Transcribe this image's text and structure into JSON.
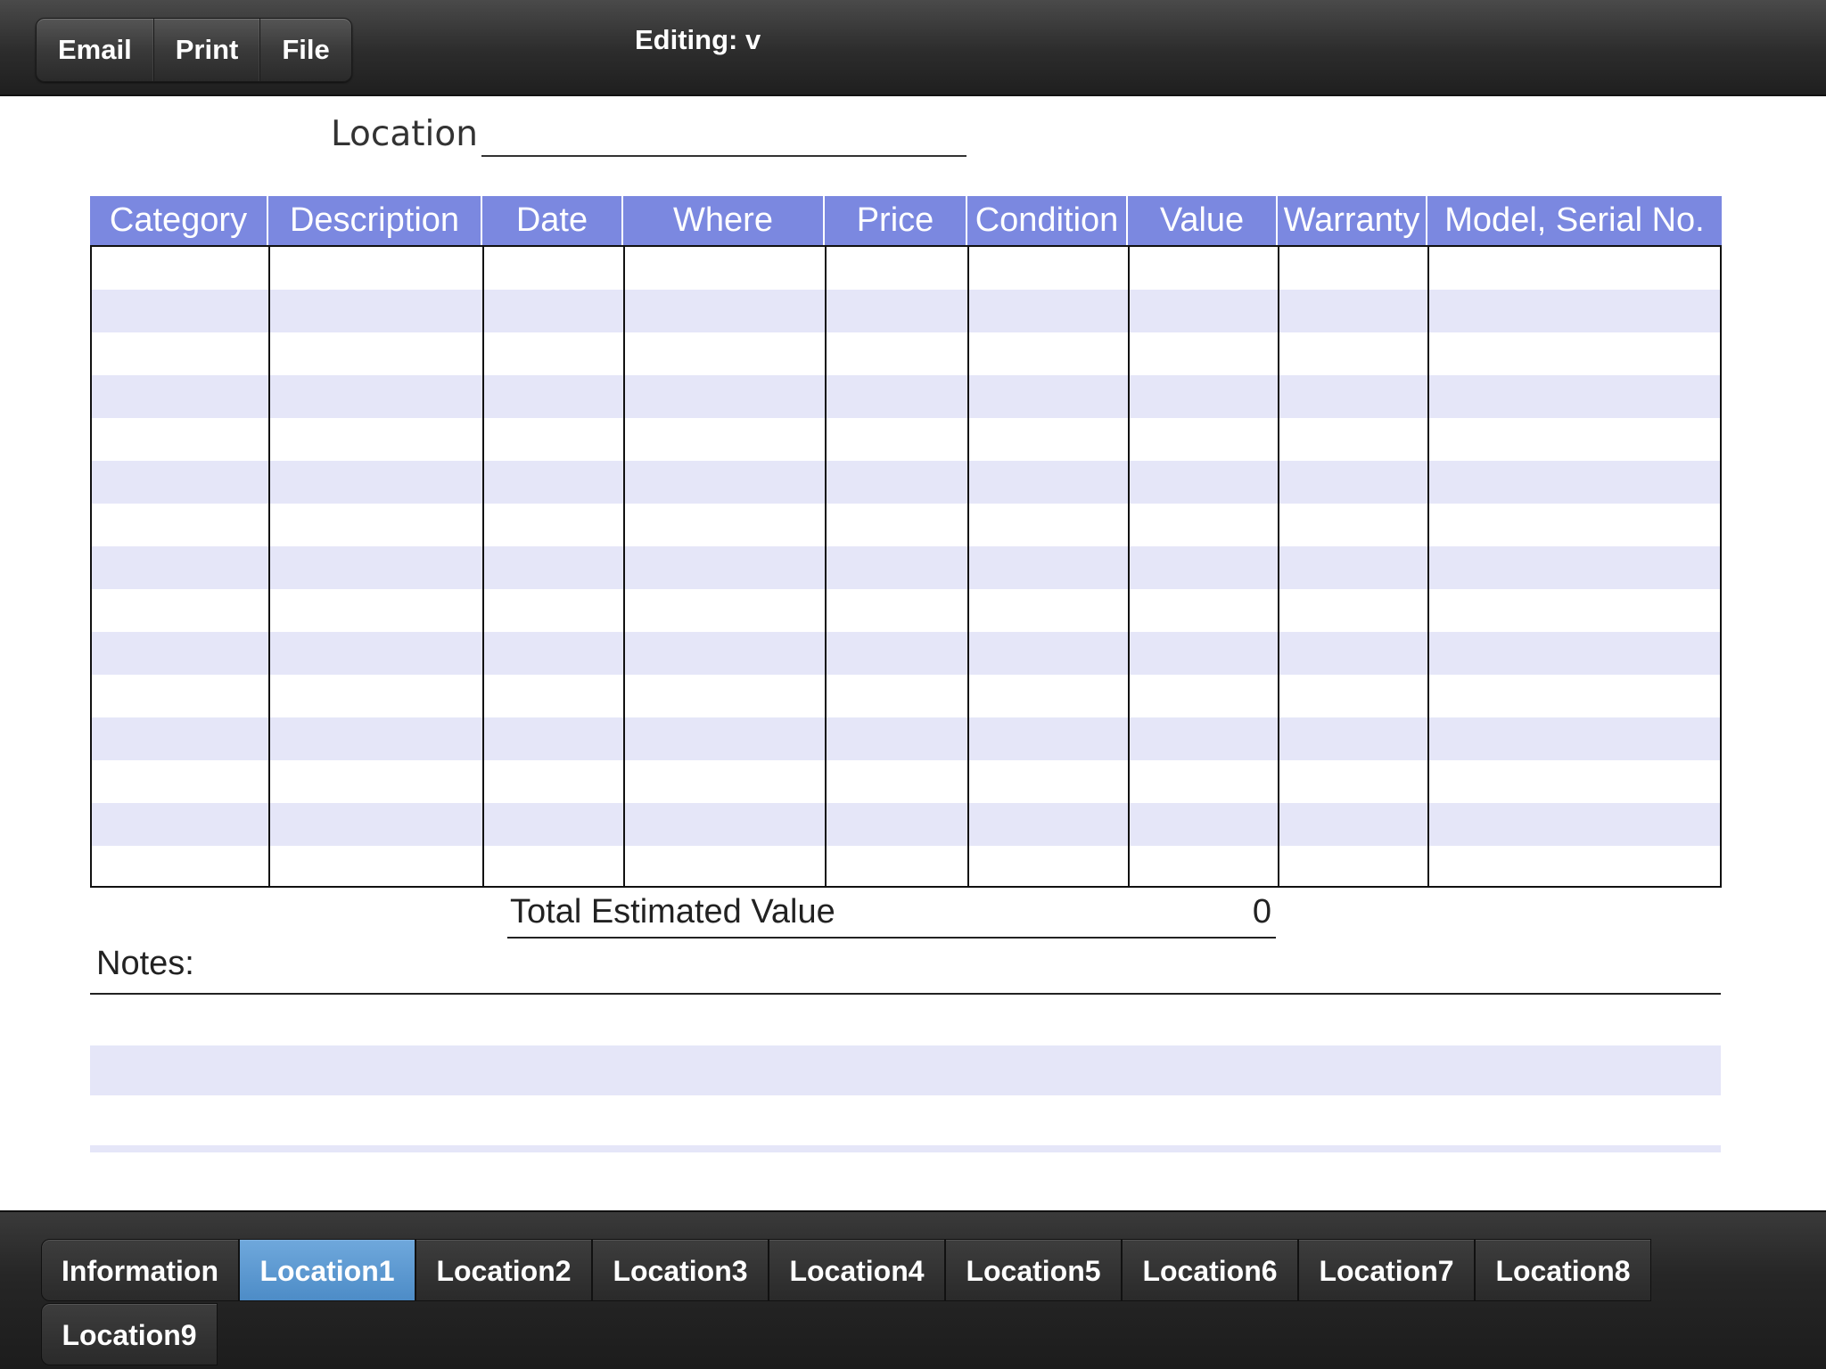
{
  "toolbar": {
    "buttons": [
      "Email",
      "Print",
      "File"
    ],
    "title": "Editing: v"
  },
  "location": {
    "label": "Location",
    "value": ""
  },
  "table": {
    "columns": [
      "Category",
      "Description",
      "Date",
      "Where",
      "Price",
      "Condition",
      "Value",
      "Warranty",
      "Model, Serial No."
    ],
    "rows": [
      [
        "",
        "",
        "",
        "",
        "",
        "",
        "",
        "",
        ""
      ],
      [
        "",
        "",
        "",
        "",
        "",
        "",
        "",
        "",
        ""
      ],
      [
        "",
        "",
        "",
        "",
        "",
        "",
        "",
        "",
        ""
      ],
      [
        "",
        "",
        "",
        "",
        "",
        "",
        "",
        "",
        ""
      ],
      [
        "",
        "",
        "",
        "",
        "",
        "",
        "",
        "",
        ""
      ],
      [
        "",
        "",
        "",
        "",
        "",
        "",
        "",
        "",
        ""
      ],
      [
        "",
        "",
        "",
        "",
        "",
        "",
        "",
        "",
        ""
      ],
      [
        "",
        "",
        "",
        "",
        "",
        "",
        "",
        "",
        ""
      ],
      [
        "",
        "",
        "",
        "",
        "",
        "",
        "",
        "",
        ""
      ],
      [
        "",
        "",
        "",
        "",
        "",
        "",
        "",
        "",
        ""
      ],
      [
        "",
        "",
        "",
        "",
        "",
        "",
        "",
        "",
        ""
      ],
      [
        "",
        "",
        "",
        "",
        "",
        "",
        "",
        "",
        ""
      ],
      [
        "",
        "",
        "",
        "",
        "",
        "",
        "",
        "",
        ""
      ],
      [
        "",
        "",
        "",
        "",
        "",
        "",
        "",
        "",
        ""
      ],
      [
        "",
        "",
        "",
        "",
        "",
        "",
        "",
        "",
        ""
      ]
    ]
  },
  "total": {
    "label": "Total Estimated Value",
    "value": "0"
  },
  "notes": {
    "label": "Notes:",
    "value": ""
  },
  "tabs": {
    "items": [
      "Information",
      "Location1",
      "Location2",
      "Location3",
      "Location4",
      "Location5",
      "Location6",
      "Location7",
      "Location8",
      "Location9"
    ],
    "selected": "Location1"
  },
  "colors": {
    "header_bg": "#7b88e0",
    "row_alt": "#e5e6f8",
    "tab_selected": "#5b9bd5"
  }
}
